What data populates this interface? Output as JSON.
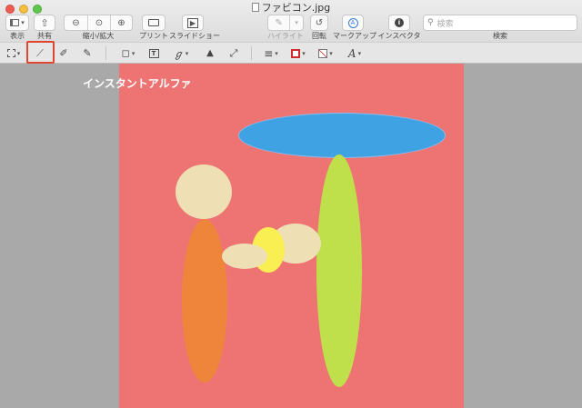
{
  "window": {
    "title": "ファビコン.jpg"
  },
  "toolbar": {
    "view_label": "表示",
    "share_label": "共有",
    "zoom_label": "縮小/拡大",
    "print_label": "プリント",
    "slideshow_label": "スライドショー",
    "highlight_label": "ハイライト",
    "rotate_label": "回転",
    "markup_label": "マークアップ",
    "inspector_label": "インスペクタ",
    "search_label": "検索",
    "search_placeholder": "検索"
  },
  "markup_tools": {
    "selection": "selection-tool",
    "instant_alpha": "instant-alpha-tool",
    "sketch": "sketch-tool",
    "draw": "draw-tool",
    "shapes": "shapes-tool",
    "text": "text-tool",
    "sign": "sign-tool",
    "adjust_color": "adjust-color-tool",
    "adjust_size": "adjust-size-tool",
    "shape_style": "shape-style-tool",
    "border_color": "#d02b2b",
    "fill_color": "fill-color-tool",
    "text_style": "A"
  },
  "canvas": {
    "caption": "インスタントアルファ",
    "background": "#ee7474"
  },
  "colors": {
    "highlight_box": "#e0462f",
    "blue_oval": "#3fa2e2",
    "green_oval": "#bfe04a",
    "orange_oval": "#ef853b",
    "cream": "#eee0b4",
    "yellow": "#f9ee52"
  }
}
